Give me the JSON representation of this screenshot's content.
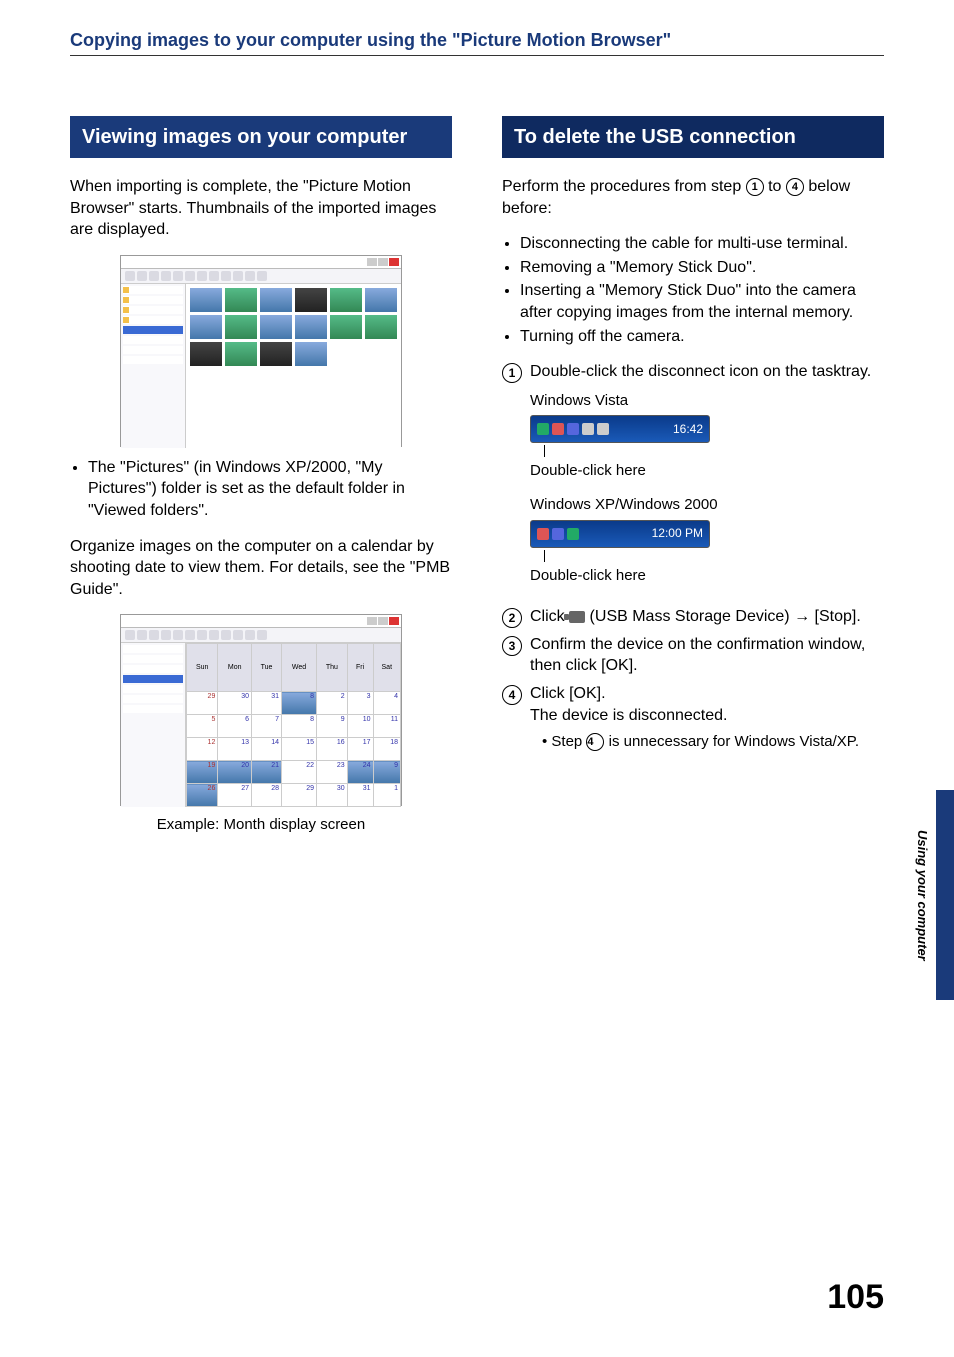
{
  "header": {
    "title": "Copying images to your computer using the \"Picture Motion Browser\""
  },
  "left": {
    "section_title": "Viewing images on your computer",
    "intro": "When importing is complete, the \"Picture Motion Browser\" starts. Thumbnails of the imported images are displayed.",
    "bullet1": "The \"Pictures\" (in Windows XP/2000, \"My Pictures\") folder is set as the default folder in \"Viewed folders\".",
    "para2": "Organize images on the computer on a calendar by shooting date to view them. For details, see the \"PMB Guide\".",
    "caption2": "Example: Month display screen"
  },
  "right": {
    "section_title": "To delete the USB connection",
    "intro_a": "Perform the procedures from step ",
    "intro_b": " to ",
    "intro_c": " below before:",
    "bullets": [
      "Disconnecting the cable for multi-use terminal.",
      "Removing a \"Memory Stick Duo\".",
      "Inserting a \"Memory Stick Duo\" into the camera after copying images from the internal memory.",
      "Turning off the camera."
    ],
    "step1": "Double-click the disconnect icon on the tasktray.",
    "vista_label": "Windows Vista",
    "vista_time": "16:42",
    "dc_here": "Double-click here",
    "xp_label": "Windows XP/Windows 2000",
    "xp_time": "12:00 PM",
    "step2_a": "Click ",
    "step2_b": " (USB Mass Storage Device) → [Stop].",
    "step3": "Confirm the device on the confirmation window, then click [OK].",
    "step4_a": "Click [OK].",
    "step4_b": "The device is disconnected.",
    "step4_note_a": "Step ",
    "step4_note_b": " is unnecessary for Windows Vista/XP."
  },
  "side_tab": "Using your computer",
  "page_number": "105",
  "calendar": {
    "headers": [
      "Sun",
      "Mon",
      "Tue",
      "Wed",
      "Thu",
      "Fri",
      "Sat"
    ]
  }
}
